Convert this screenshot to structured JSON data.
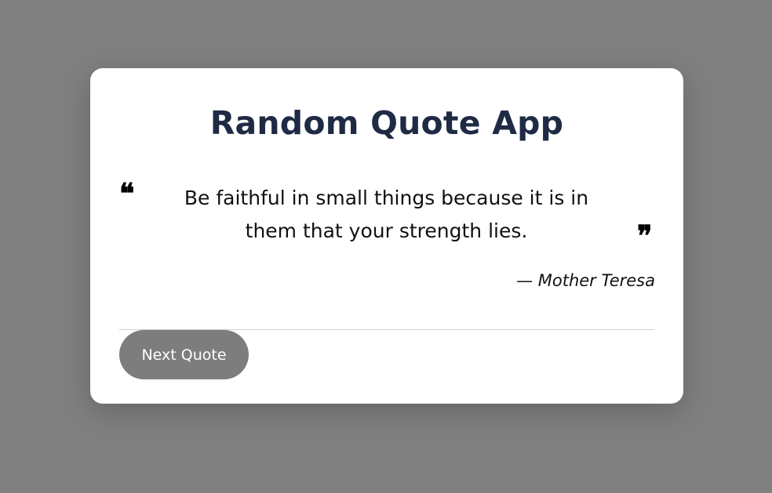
{
  "app": {
    "title": "Random Quote App"
  },
  "quote": {
    "open_mark": "❝",
    "close_mark": "❞",
    "text": "Be faithful in small things because it is in them that your strength lies.",
    "author": "— Mother Teresa"
  },
  "actions": {
    "next_label": "Next Quote"
  },
  "colors": {
    "background": "#808080",
    "card": "#ffffff",
    "title": "#1f2a44",
    "button": "#7d7d7d"
  }
}
